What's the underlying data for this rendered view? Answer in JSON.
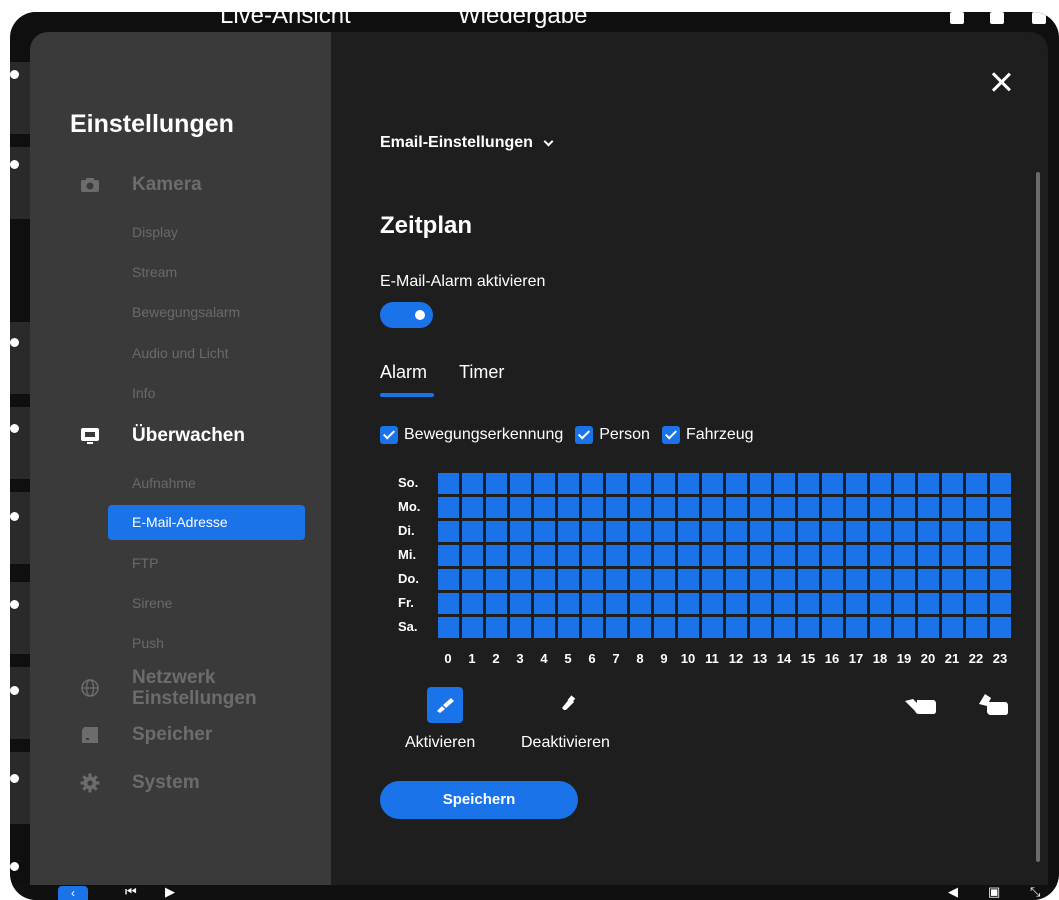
{
  "background": {
    "tabs": [
      "Live-Ansicht",
      "Wiedergabe"
    ]
  },
  "sidebar": {
    "title": "Einstellungen",
    "categories": [
      {
        "label": "Kamera",
        "icon": "camera-icon",
        "active": false,
        "items": [
          "Display",
          "Stream",
          "Bewegungsalarm",
          "Audio und Licht",
          "Info"
        ]
      },
      {
        "label": "Überwachen",
        "icon": "monitor-icon",
        "active": true,
        "items": [
          "Aufnahme",
          "E-Mail-Adresse",
          "FTP",
          "Sirene",
          "Push"
        ],
        "selected": "E-Mail-Adresse"
      },
      {
        "label": "Netzwerk Einstellungen",
        "icon": "globe-icon",
        "active": false,
        "items": []
      },
      {
        "label": "Speicher",
        "icon": "storage-icon",
        "active": false,
        "items": []
      },
      {
        "label": "System",
        "icon": "gear-icon",
        "active": false,
        "items": []
      }
    ]
  },
  "main": {
    "section_dropdown": "Email-Einstellungen",
    "heading": "Zeitplan",
    "enable_label": "E-Mail-Alarm aktivieren",
    "enable_on": true,
    "tabs": [
      "Alarm",
      "Timer"
    ],
    "active_tab": "Alarm",
    "detection_types": [
      {
        "label": "Bewegungserkennung",
        "checked": true
      },
      {
        "label": "Person",
        "checked": true
      },
      {
        "label": "Fahrzeug",
        "checked": true
      }
    ],
    "days": [
      "So.",
      "Mo.",
      "Di.",
      "Mi.",
      "Do.",
      "Fr.",
      "Sa."
    ],
    "hours": [
      "0",
      "1",
      "2",
      "3",
      "4",
      "5",
      "6",
      "7",
      "8",
      "9",
      "10",
      "11",
      "12",
      "13",
      "14",
      "15",
      "16",
      "17",
      "18",
      "19",
      "20",
      "21",
      "22",
      "23"
    ],
    "schedule_all_active": true,
    "tool_activate": "Aktivieren",
    "tool_deactivate": "Deaktivieren",
    "save_label": "Speichern"
  },
  "colors": {
    "accent": "#1a73e8",
    "panel": "#1e1e1e",
    "sidebar": "#3a3a3a"
  }
}
